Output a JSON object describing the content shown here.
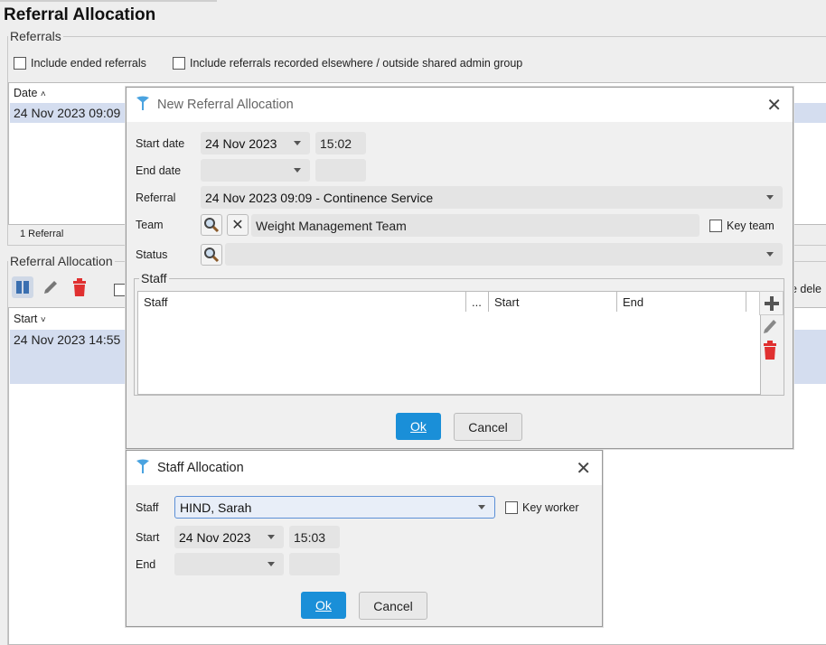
{
  "background": {
    "title": "Referral Allocation",
    "referrals_legend": "Referrals",
    "include_ended": "Include ended referrals",
    "include_elsewhere": "Include referrals recorded elsewhere / outside shared admin group",
    "date_header": "Date",
    "referral_row": "24 Nov 2023 09:09",
    "referral_count": "1 Referral",
    "allocation_legend": "Referral Allocation",
    "start_header": "Start",
    "allocation_row": "24 Nov 2023 14:55",
    "right_fragment": "de dele"
  },
  "new_referral_dialog": {
    "title": "New Referral Allocation",
    "start_date_label": "Start date",
    "start_date_value": "24 Nov 2023",
    "start_time_value": "15:02",
    "end_date_label": "End date",
    "end_date_value": "",
    "end_time_value": "",
    "referral_label": "Referral",
    "referral_value": "24 Nov 2023 09:09 - Continence Service",
    "team_label": "Team",
    "team_value": "Weight Management Team",
    "key_team_label": "Key team",
    "status_label": "Status",
    "status_value": "",
    "staff_legend": "Staff",
    "columns": [
      "Staff",
      "...",
      "Start",
      "End"
    ],
    "ok_label": "Ok",
    "cancel_label": "Cancel"
  },
  "staff_dialog": {
    "title": "Staff Allocation",
    "staff_label": "Staff",
    "staff_value": "HIND, Sarah",
    "key_worker_label": "Key worker",
    "start_label": "Start",
    "start_date_value": "24 Nov 2023",
    "start_time_value": "15:03",
    "end_label": "End",
    "end_date_value": "",
    "end_time_value": "",
    "ok_label": "Ok",
    "cancel_label": "Cancel"
  },
  "colors": {
    "accent": "#1a8fd8",
    "selection": "#d4ddef",
    "delete": "#e03030"
  }
}
